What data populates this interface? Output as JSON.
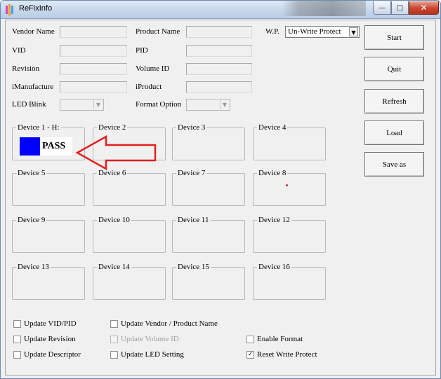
{
  "window": {
    "title": "ReFixInfo"
  },
  "fields": {
    "vendor_name": {
      "label": "Vendor Name",
      "value": ""
    },
    "product_name": {
      "label": "Product Name",
      "value": ""
    },
    "vid": {
      "label": "VID",
      "value": ""
    },
    "pid": {
      "label": "PID",
      "value": ""
    },
    "revision": {
      "label": "Revision",
      "value": ""
    },
    "volume_id": {
      "label": "Volume ID",
      "value": ""
    },
    "imanufacture": {
      "label": "iManufacture",
      "value": ""
    },
    "iproduct": {
      "label": "iProduct",
      "value": ""
    },
    "led_blink": {
      "label": "LED Blink",
      "value": ""
    },
    "format_option": {
      "label": "Format Option",
      "value": ""
    },
    "wp": {
      "label": "W.P.",
      "value": "Un-Write Protect"
    }
  },
  "buttons": {
    "start": "Start",
    "quit": "Quit",
    "refresh": "Refresh",
    "load": "Load",
    "save_as": "Save as"
  },
  "devices": [
    {
      "label": "Device 1 - H:",
      "status": "PASS",
      "status_color": "#0000ff"
    },
    {
      "label": "Device 2"
    },
    {
      "label": "Device 3"
    },
    {
      "label": "Device 4"
    },
    {
      "label": "Device 5"
    },
    {
      "label": "Device 6"
    },
    {
      "label": "Device 7"
    },
    {
      "label": "Device 8"
    },
    {
      "label": "Device 9"
    },
    {
      "label": "Device 10"
    },
    {
      "label": "Device 11"
    },
    {
      "label": "Device 12"
    },
    {
      "label": "Device 13"
    },
    {
      "label": "Device 14"
    },
    {
      "label": "Device 15"
    },
    {
      "label": "Device 16"
    }
  ],
  "options": {
    "update_vid_pid": {
      "label": "Update VID/PID",
      "checked": false,
      "enabled": true
    },
    "update_vendor_product": {
      "label": "Update Vendor / Product Name",
      "checked": false,
      "enabled": true
    },
    "update_revision": {
      "label": "Update Revision",
      "checked": false,
      "enabled": true
    },
    "update_volume_id": {
      "label": "Update Volume ID",
      "checked": false,
      "enabled": false
    },
    "enable_format": {
      "label": "Enable Format",
      "checked": false,
      "enabled": true
    },
    "update_descriptor": {
      "label": "Update Descriptor",
      "checked": false,
      "enabled": true
    },
    "update_led_setting": {
      "label": "Update LED Setting",
      "checked": false,
      "enabled": true
    },
    "reset_write_protect": {
      "label": "Reset Write Protect",
      "checked": true,
      "enabled": true
    }
  },
  "colors": {
    "annotation_arrow": "#e02020",
    "pass_indicator": "#0000ff"
  },
  "icons": {
    "app": "refixinfo-app-icon",
    "annotation": "red-arrow-icon"
  }
}
